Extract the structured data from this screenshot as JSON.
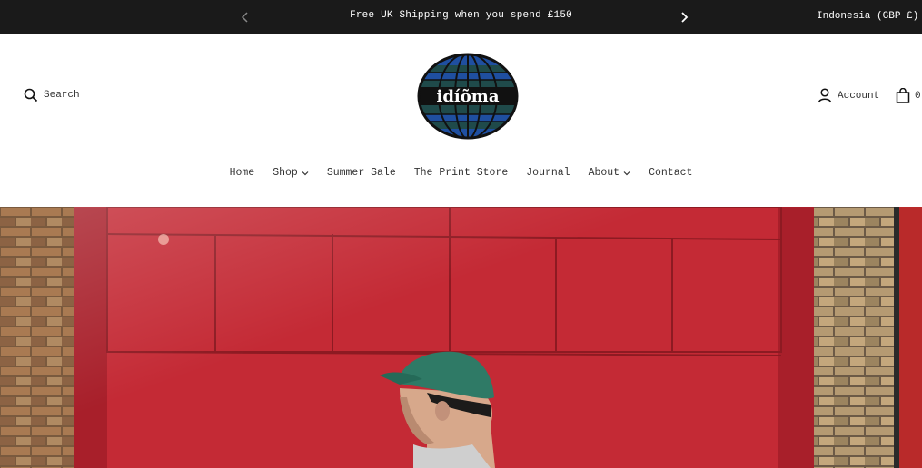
{
  "announcement": {
    "message": "Free UK Shipping when you spend £150",
    "prev_icon": "chevron-left-icon",
    "next_icon": "chevron-right-icon"
  },
  "currency": {
    "selected": "Indonesia (GBP £)"
  },
  "header": {
    "search_label": "Search",
    "logo_text": "idíõma",
    "account_label": "Account",
    "cart_count": "0"
  },
  "nav": {
    "items": [
      {
        "label": "Home",
        "has_dropdown": false
      },
      {
        "label": "Shop",
        "has_dropdown": true
      },
      {
        "label": "Summer Sale",
        "has_dropdown": false
      },
      {
        "label": "The Print Store",
        "has_dropdown": false
      },
      {
        "label": "Journal",
        "has_dropdown": false
      },
      {
        "label": "About",
        "has_dropdown": true
      },
      {
        "label": "Contact",
        "has_dropdown": false
      }
    ]
  },
  "colors": {
    "topbar_bg": "#1a1a1a",
    "hero_red": "#c42a35",
    "logo_blue": "#1f4fa0",
    "logo_teal": "#1f4a4a"
  }
}
